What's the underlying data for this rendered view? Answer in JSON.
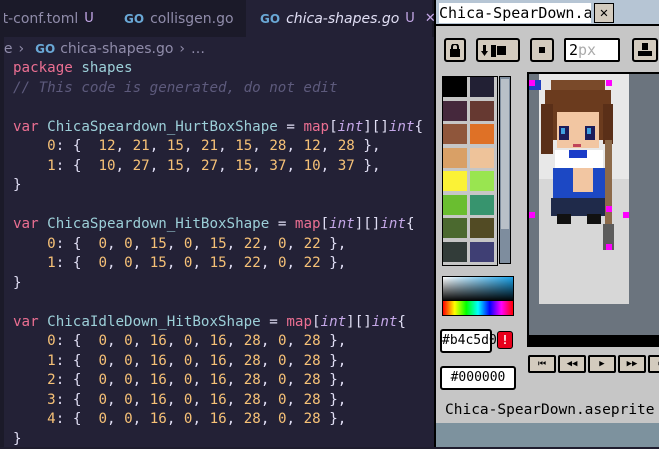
{
  "editor": {
    "tabs": [
      {
        "label": "et-conf.toml",
        "status": "U",
        "active": false
      },
      {
        "label": "collisgen.go",
        "status": "",
        "active": false
      },
      {
        "label": "chica-shapes.go",
        "status": "U",
        "active": true
      }
    ],
    "active_tab_close": "✕",
    "breadcrumb": {
      "parent": "le",
      "file": "chica-shapes.go",
      "more": "…"
    },
    "code_lines": [
      "package shapes",
      "// This code is generated, do not edit",
      "",
      "var ChicaSpeardown_HurtBoxShape = map[int][]int{",
      "    0: {  12, 21, 15, 21, 15, 28, 12, 28 },",
      "    1: {  10, 27, 15, 27, 15, 37, 10, 37 },",
      "}",
      "",
      "var ChicaSpeardown_HitBoxShape = map[int][]int{",
      "    0: {  0, 0, 15, 0, 15, 22, 0, 22 },",
      "    1: {  0, 0, 15, 0, 15, 22, 0, 22 },",
      "}",
      "",
      "var ChicaIdleDown_HitBoxShape = map[int][]int{",
      "    0: {  0, 0, 16, 0, 16, 28, 0, 28 },",
      "    1: {  0, 0, 16, 0, 16, 28, 0, 28 },",
      "    2: {  0, 0, 16, 0, 16, 28, 0, 28 },",
      "    3: {  0, 0, 16, 0, 16, 28, 0, 28 },",
      "    4: {  0, 0, 16, 0, 16, 28, 0, 28 },",
      "}"
    ]
  },
  "aseprite": {
    "title": "Chica-SpearDown.aseprite",
    "title_close": "✕",
    "brush_size": "2",
    "brush_unit": "px",
    "fg_color_hex": "b4c5d0",
    "fg_color_label": "#b4c5d0",
    "bg_color_label": "#000000",
    "status_text": "Chica-SpearDown.aseprite",
    "palette_colors": [
      "#000000",
      "#222034",
      "#45283c",
      "#663931",
      "#8f563b",
      "#df7126",
      "#d9a066",
      "#eec39a",
      "#fbf236",
      "#99e550",
      "#6abe30",
      "#37946e",
      "#4b692f",
      "#524b24",
      "#323c39",
      "#3f3f74"
    ],
    "timeline_buttons": [
      "⏮",
      "◀◀",
      "▶",
      "▶▶",
      "⏭"
    ]
  }
}
